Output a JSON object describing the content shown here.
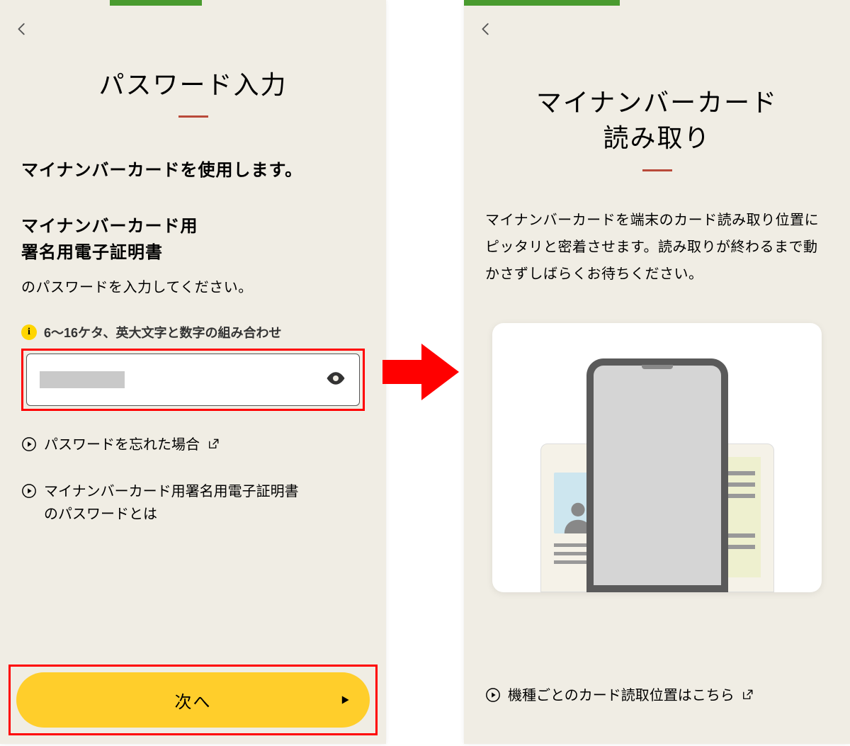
{
  "left": {
    "title": "パスワード入力",
    "subtitle1": "マイナンバーカードを使用します。",
    "cert_label_l1": "マイナンバーカード用",
    "cert_label_l2": "署名用電子証明書",
    "helper": "のパスワードを入力してください。",
    "info_hint": "6～16ケタ、英大文字と数字の組み合わせ",
    "link_forgot": "パスワードを忘れた場合",
    "link_whatis_l1": "マイナンバーカード用署名用電子証明書",
    "link_whatis_l2": "のパスワードとは",
    "next_btn": "次へ"
  },
  "right": {
    "title_l1": "マイナンバーカード",
    "title_l2": "読み取り",
    "body": "マイナンバーカードを端末のカード読み取り位置にピッタリと密着させます。読み取りが終わるまで動かさずしばらくお待ちください。",
    "link_position": "機種ごとのカード読取位置はこちら"
  }
}
